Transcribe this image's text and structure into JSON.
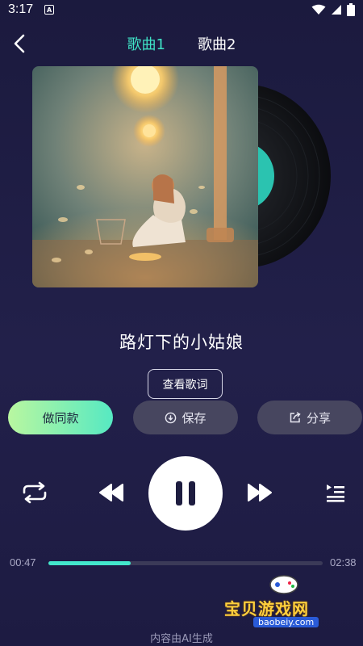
{
  "status": {
    "time": "3:17",
    "notif_icon": "A"
  },
  "header": {
    "tabs": [
      {
        "label": "歌曲1",
        "active": true
      },
      {
        "label": "歌曲2",
        "active": false
      }
    ]
  },
  "song": {
    "title": "路灯下的小姑娘"
  },
  "buttons": {
    "lyrics": "查看歌词",
    "same_style": "做同款",
    "save": "保存",
    "share": "分享"
  },
  "progress": {
    "current": "00:47",
    "total": "02:38",
    "fraction": 0.3
  },
  "watermark": {
    "text": "宝贝游戏网",
    "url": "baobeiy.com"
  },
  "footer": {
    "ai_note": "内容由AI生成"
  },
  "colors": {
    "accent": "#3fe3c6",
    "progress": "#43e7cc"
  }
}
